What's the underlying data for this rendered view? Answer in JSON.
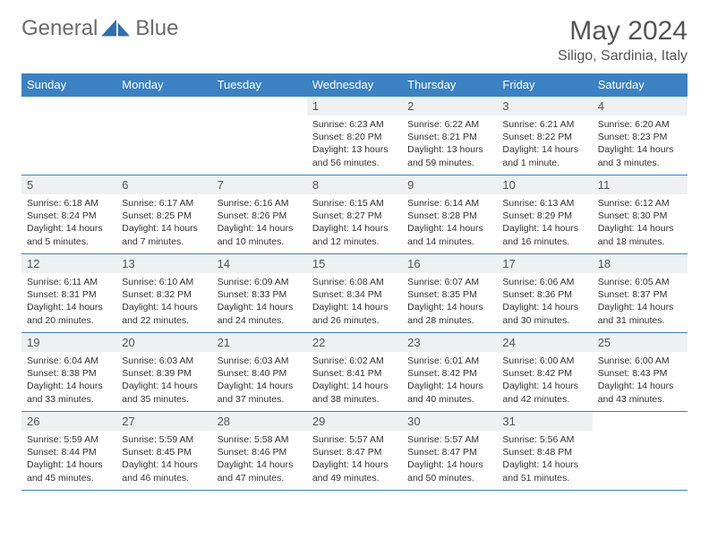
{
  "logo": {
    "word1": "General",
    "word2": "Blue"
  },
  "title": "May 2024",
  "location": "Siligo, Sardinia, Italy",
  "weekdays": [
    "Sunday",
    "Monday",
    "Tuesday",
    "Wednesday",
    "Thursday",
    "Friday",
    "Saturday"
  ],
  "weeks": [
    [
      null,
      null,
      null,
      {
        "n": "1",
        "sr": "6:23 AM",
        "ss": "8:20 PM",
        "dl": "13 hours and 56 minutes."
      },
      {
        "n": "2",
        "sr": "6:22 AM",
        "ss": "8:21 PM",
        "dl": "13 hours and 59 minutes."
      },
      {
        "n": "3",
        "sr": "6:21 AM",
        "ss": "8:22 PM",
        "dl": "14 hours and 1 minute."
      },
      {
        "n": "4",
        "sr": "6:20 AM",
        "ss": "8:23 PM",
        "dl": "14 hours and 3 minutes."
      }
    ],
    [
      {
        "n": "5",
        "sr": "6:18 AM",
        "ss": "8:24 PM",
        "dl": "14 hours and 5 minutes."
      },
      {
        "n": "6",
        "sr": "6:17 AM",
        "ss": "8:25 PM",
        "dl": "14 hours and 7 minutes."
      },
      {
        "n": "7",
        "sr": "6:16 AM",
        "ss": "8:26 PM",
        "dl": "14 hours and 10 minutes."
      },
      {
        "n": "8",
        "sr": "6:15 AM",
        "ss": "8:27 PM",
        "dl": "14 hours and 12 minutes."
      },
      {
        "n": "9",
        "sr": "6:14 AM",
        "ss": "8:28 PM",
        "dl": "14 hours and 14 minutes."
      },
      {
        "n": "10",
        "sr": "6:13 AM",
        "ss": "8:29 PM",
        "dl": "14 hours and 16 minutes."
      },
      {
        "n": "11",
        "sr": "6:12 AM",
        "ss": "8:30 PM",
        "dl": "14 hours and 18 minutes."
      }
    ],
    [
      {
        "n": "12",
        "sr": "6:11 AM",
        "ss": "8:31 PM",
        "dl": "14 hours and 20 minutes."
      },
      {
        "n": "13",
        "sr": "6:10 AM",
        "ss": "8:32 PM",
        "dl": "14 hours and 22 minutes."
      },
      {
        "n": "14",
        "sr": "6:09 AM",
        "ss": "8:33 PM",
        "dl": "14 hours and 24 minutes."
      },
      {
        "n": "15",
        "sr": "6:08 AM",
        "ss": "8:34 PM",
        "dl": "14 hours and 26 minutes."
      },
      {
        "n": "16",
        "sr": "6:07 AM",
        "ss": "8:35 PM",
        "dl": "14 hours and 28 minutes."
      },
      {
        "n": "17",
        "sr": "6:06 AM",
        "ss": "8:36 PM",
        "dl": "14 hours and 30 minutes."
      },
      {
        "n": "18",
        "sr": "6:05 AM",
        "ss": "8:37 PM",
        "dl": "14 hours and 31 minutes."
      }
    ],
    [
      {
        "n": "19",
        "sr": "6:04 AM",
        "ss": "8:38 PM",
        "dl": "14 hours and 33 minutes."
      },
      {
        "n": "20",
        "sr": "6:03 AM",
        "ss": "8:39 PM",
        "dl": "14 hours and 35 minutes."
      },
      {
        "n": "21",
        "sr": "6:03 AM",
        "ss": "8:40 PM",
        "dl": "14 hours and 37 minutes."
      },
      {
        "n": "22",
        "sr": "6:02 AM",
        "ss": "8:41 PM",
        "dl": "14 hours and 38 minutes."
      },
      {
        "n": "23",
        "sr": "6:01 AM",
        "ss": "8:42 PM",
        "dl": "14 hours and 40 minutes."
      },
      {
        "n": "24",
        "sr": "6:00 AM",
        "ss": "8:42 PM",
        "dl": "14 hours and 42 minutes."
      },
      {
        "n": "25",
        "sr": "6:00 AM",
        "ss": "8:43 PM",
        "dl": "14 hours and 43 minutes."
      }
    ],
    [
      {
        "n": "26",
        "sr": "5:59 AM",
        "ss": "8:44 PM",
        "dl": "14 hours and 45 minutes."
      },
      {
        "n": "27",
        "sr": "5:59 AM",
        "ss": "8:45 PM",
        "dl": "14 hours and 46 minutes."
      },
      {
        "n": "28",
        "sr": "5:58 AM",
        "ss": "8:46 PM",
        "dl": "14 hours and 47 minutes."
      },
      {
        "n": "29",
        "sr": "5:57 AM",
        "ss": "8:47 PM",
        "dl": "14 hours and 49 minutes."
      },
      {
        "n": "30",
        "sr": "5:57 AM",
        "ss": "8:47 PM",
        "dl": "14 hours and 50 minutes."
      },
      {
        "n": "31",
        "sr": "5:56 AM",
        "ss": "8:48 PM",
        "dl": "14 hours and 51 minutes."
      },
      null
    ]
  ],
  "labels": {
    "sunrise": "Sunrise:",
    "sunset": "Sunset:",
    "daylight": "Daylight:"
  }
}
